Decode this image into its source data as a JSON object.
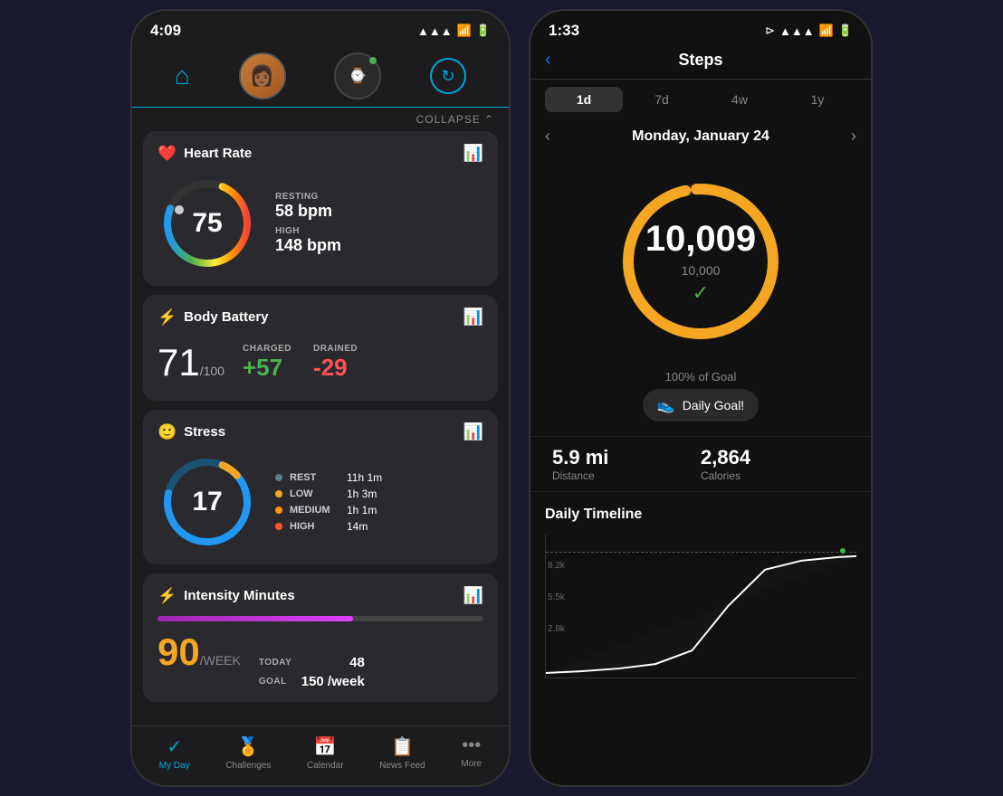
{
  "leftPhone": {
    "statusBar": {
      "time": "4:09",
      "signal": "▲▲▲",
      "wifi": "WiFi",
      "battery": "Battery"
    },
    "collapseBtn": "COLLAPSE",
    "heartRate": {
      "title": "Heart Rate",
      "icon": "❤️",
      "currentBpm": "75",
      "restingLabel": "RESTING",
      "restingValue": "58 bpm",
      "highLabel": "HIGH",
      "highValue": "148 bpm"
    },
    "bodyBattery": {
      "title": "Body Battery",
      "icon": "⚡",
      "value": "71",
      "outOf": "/100",
      "chargedLabel": "CHARGED",
      "chargedValue": "+57",
      "drainedLabel": "DRAINED",
      "drainedValue": "-29"
    },
    "stress": {
      "title": "Stress",
      "icon": "😰",
      "value": "17",
      "legend": [
        {
          "label": "REST",
          "time": "11h 1m",
          "color": "#607d8b"
        },
        {
          "label": "LOW",
          "time": "1h 3m",
          "color": "#f5a623"
        },
        {
          "label": "MEDIUM",
          "time": "1h 1m",
          "color": "#ff9800"
        },
        {
          "label": "HIGH",
          "time": "14m",
          "color": "#ff5722"
        }
      ]
    },
    "intensityMinutes": {
      "title": "Intensity Minutes",
      "icon": "🔥",
      "value": "90",
      "unit": "/WEEK",
      "barPercent": 60,
      "todayLabel": "TODAY",
      "todayValue": "48",
      "goalLabel": "GOAL",
      "goalValue": "150 /week"
    },
    "bottomNav": [
      {
        "label": "My Day",
        "icon": "✓",
        "active": true
      },
      {
        "label": "Challenges",
        "icon": "🏅",
        "active": false
      },
      {
        "label": "Calendar",
        "icon": "📅",
        "active": false
      },
      {
        "label": "News Feed",
        "icon": "📋",
        "active": false
      },
      {
        "label": "More",
        "icon": "•••",
        "active": false
      }
    ]
  },
  "rightPhone": {
    "statusBar": {
      "time": "1:33",
      "signal": "▲▲▲"
    },
    "title": "Steps",
    "backBtn": "‹",
    "tabs": [
      {
        "label": "1d",
        "active": true
      },
      {
        "label": "7d",
        "active": false
      },
      {
        "label": "4w",
        "active": false
      },
      {
        "label": "1y",
        "active": false
      }
    ],
    "date": "Monday, January 24",
    "steps": {
      "value": "10,009",
      "goal": "10,000",
      "goalPct": "100% of Goal",
      "check": "✓"
    },
    "dailyGoalBtn": "Daily Goal!",
    "distance": {
      "value": "5.9 mi",
      "label": "Distance"
    },
    "calories": {
      "value": "2,864",
      "label": "Calories"
    },
    "dailyTimelineTitle": "Daily Timeline",
    "chart": {
      "yLabels": [
        "8.2k",
        "5.5k",
        "2.8k"
      ],
      "dashed": true
    }
  }
}
